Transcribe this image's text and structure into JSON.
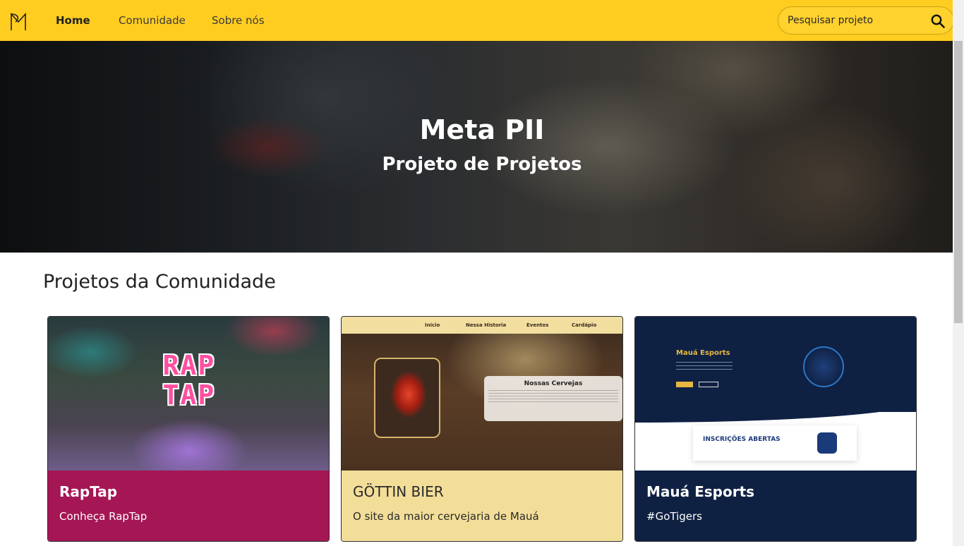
{
  "navbar": {
    "logo_icon": "meta-pii-logo-icon",
    "links": [
      {
        "label": "Home",
        "active": true
      },
      {
        "label": "Comunidade",
        "active": false
      },
      {
        "label": "Sobre nós",
        "active": false
      }
    ],
    "search": {
      "placeholder": "Pesquisar projeto",
      "value": "",
      "icon": "search-icon"
    },
    "color": "#ffcd20"
  },
  "hero": {
    "title": "Meta PII",
    "subtitle": "Projeto de Projetos"
  },
  "section": {
    "title": "Projetos da Comunidade"
  },
  "cards": [
    {
      "title": "RapTap",
      "text": "Conheça RapTap",
      "color": "#a51655",
      "image_text": "RAP TAP"
    },
    {
      "title": "GÖTTIN BIER",
      "text": "O site da maior cervejaria de Mauá",
      "color": "#f3de99",
      "image": {
        "nav_items": [
          "Inicio",
          "Nessa Historia",
          "Eventos",
          "Cardápio"
        ],
        "box_title": "Nossas Cervejas"
      }
    },
    {
      "title": "Mauá Esports",
      "text": "#GoTigers",
      "color": "#0f2143",
      "image": {
        "heading": "Mauá Esports",
        "banner_text": "INSCRIÇÕES ABERTAS"
      }
    }
  ]
}
